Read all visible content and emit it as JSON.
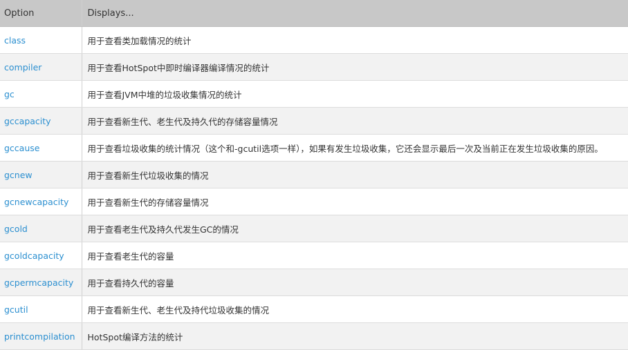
{
  "table": {
    "headers": {
      "option": "Option",
      "displays": "Displays..."
    },
    "rows": [
      {
        "option": "class",
        "description": "用于查看类加载情况的统计"
      },
      {
        "option": "compiler",
        "description": "用于查看HotSpot中即时编译器编译情况的统计"
      },
      {
        "option": "gc",
        "description": "用于查看JVM中堆的垃圾收集情况的统计"
      },
      {
        "option": "gccapacity",
        "description": "用于查看新生代、老生代及持久代的存储容量情况"
      },
      {
        "option": "gccause",
        "description": "用于查看垃圾收集的统计情况（这个和-gcutil选项一样），如果有发生垃圾收集，它还会显示最后一次及当前正在发生垃圾收集的原因。"
      },
      {
        "option": "gcnew",
        "description": "用于查看新生代垃圾收集的情况"
      },
      {
        "option": "gcnewcapacity",
        "description": "用于查看新生代的存储容量情况"
      },
      {
        "option": "gcold",
        "description": "用于查看老生代及持久代发生GC的情况"
      },
      {
        "option": "gcoldcapacity",
        "description": "用于查看老生代的容量"
      },
      {
        "option": "gcpermcapacity",
        "description": "用于查看持久代的容量"
      },
      {
        "option": "gcutil",
        "description": "用于查看新生代、老生代及持代垃圾收集的情况"
      },
      {
        "option": "printcompilation",
        "description": "HotSpot编译方法的统计"
      }
    ]
  },
  "colors": {
    "header_bg": "#c8c8c8",
    "link": "#2b8fd0",
    "stripe": "#f2f2f2"
  }
}
